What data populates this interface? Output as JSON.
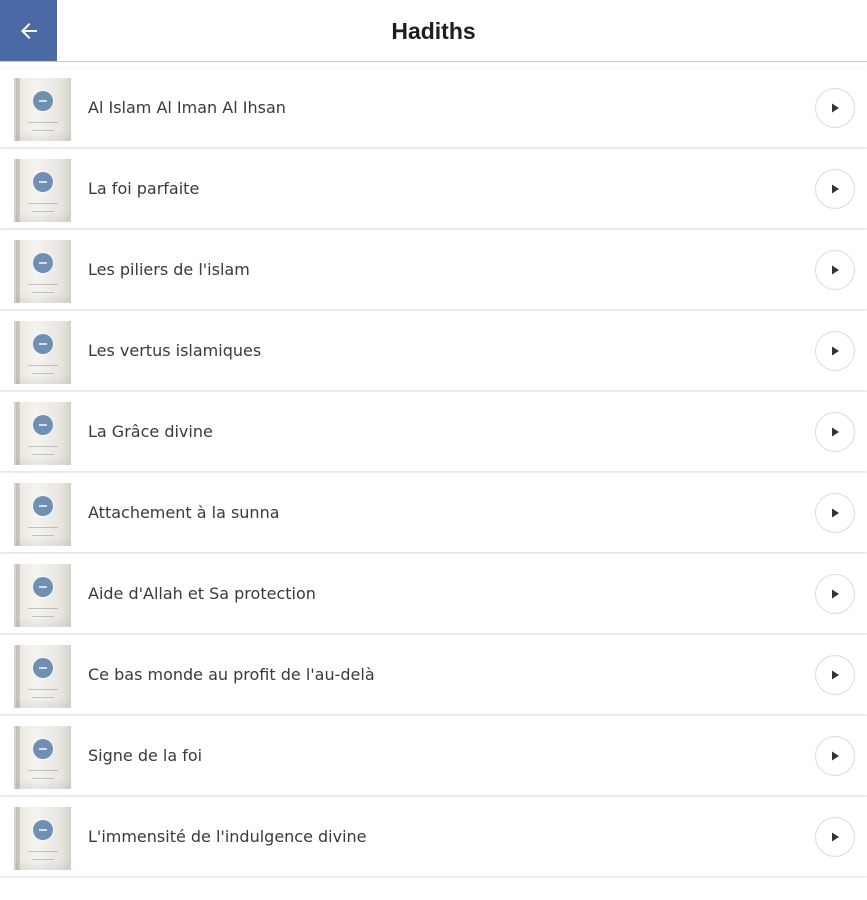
{
  "header": {
    "title": "Hadiths",
    "back_icon": "arrow-left-icon",
    "accent_color": "#4a69a5"
  },
  "items": [
    {
      "label": "Al Islam Al Iman Al Ihsan"
    },
    {
      "label": "La foi parfaite"
    },
    {
      "label": "Les piliers de l'islam"
    },
    {
      "label": "Les vertus islamiques"
    },
    {
      "label": "La Grâce divine"
    },
    {
      "label": "Attachement à la sunna"
    },
    {
      "label": "Aide d'Allah et Sa protection"
    },
    {
      "label": "Ce bas monde au profit de l'au-delà"
    },
    {
      "label": "Signe de la foi"
    },
    {
      "label": "L'immensité de l'indulgence divine"
    }
  ],
  "item_icon": "play-icon",
  "thumbnail_icon": "book-cover-icon"
}
